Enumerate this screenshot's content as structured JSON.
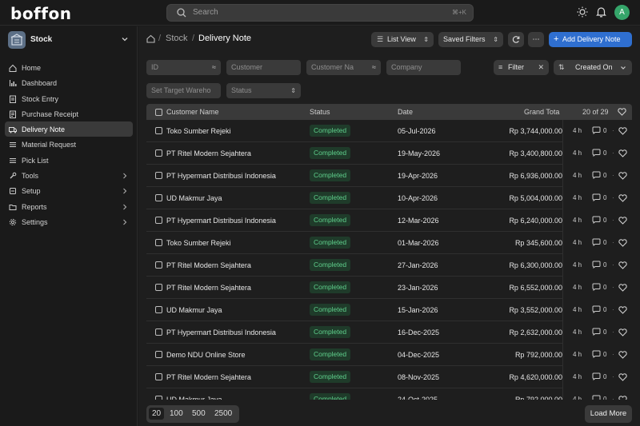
{
  "app": {
    "logo": "boffon"
  },
  "search": {
    "placeholder": "Search",
    "shortcut": "⌘+K"
  },
  "user": {
    "avatar_initial": "A"
  },
  "workspace": {
    "label": "Stock"
  },
  "sidebar": {
    "items": [
      {
        "label": "Home",
        "icon": "home-icon"
      },
      {
        "label": "Dashboard",
        "icon": "chart-icon"
      },
      {
        "label": "Stock Entry",
        "icon": "doc-icon"
      },
      {
        "label": "Purchase Receipt",
        "icon": "receipt-icon"
      },
      {
        "label": "Delivery Note",
        "icon": "truck-icon",
        "active": true
      },
      {
        "label": "Material Request",
        "icon": "list-icon"
      },
      {
        "label": "Pick List",
        "icon": "list-icon"
      },
      {
        "label": "Tools",
        "icon": "tools-icon",
        "chevron": true
      },
      {
        "label": "Setup",
        "icon": "setup-icon",
        "chevron": true
      },
      {
        "label": "Reports",
        "icon": "folder-icon",
        "chevron": true
      },
      {
        "label": "Settings",
        "icon": "gear-icon",
        "chevron": true
      }
    ]
  },
  "breadcrumb": {
    "section": "Stock",
    "page": "Delivery Note"
  },
  "toolbar": {
    "list_view": "List View",
    "saved_filters": "Saved Filters",
    "add_label": "Add Delivery Note"
  },
  "filters": {
    "id": "ID",
    "customer": "Customer",
    "customer_name": "Customer Na",
    "company": "Company",
    "set_target_warehouse": "Set Target Wareho",
    "status": "Status",
    "filter_label": "Filter",
    "sort_label": "Created On"
  },
  "table": {
    "headers": {
      "customer_name": "Customer Name",
      "status": "Status",
      "date": "Date",
      "grand_total": "Grand Tota",
      "count": "20 of 29"
    },
    "rows": [
      {
        "customer": "Toko Sumber Rejeki",
        "status": "Completed",
        "date": "05-Jul-2026",
        "total": "Rp 3,744,000.00",
        "age": "4 h",
        "comments": "0"
      },
      {
        "customer": "PT Ritel Modern Sejahtera",
        "status": "Completed",
        "date": "19-May-2026",
        "total": "Rp 3,400,800.00",
        "age": "4 h",
        "comments": "0"
      },
      {
        "customer": "PT Hypermart Distribusi Indonesia",
        "status": "Completed",
        "date": "19-Apr-2026",
        "total": "Rp 6,936,000.00",
        "age": "4 h",
        "comments": "0"
      },
      {
        "customer": "UD Makmur Jaya",
        "status": "Completed",
        "date": "10-Apr-2026",
        "total": "Rp 5,004,000.00",
        "age": "4 h",
        "comments": "0"
      },
      {
        "customer": "PT Hypermart Distribusi Indonesia",
        "status": "Completed",
        "date": "12-Mar-2026",
        "total": "Rp 6,240,000.00",
        "age": "4 h",
        "comments": "0"
      },
      {
        "customer": "Toko Sumber Rejeki",
        "status": "Completed",
        "date": "01-Mar-2026",
        "total": "Rp 345,600.00",
        "age": "4 h",
        "comments": "0"
      },
      {
        "customer": "PT Ritel Modern Sejahtera",
        "status": "Completed",
        "date": "27-Jan-2026",
        "total": "Rp 6,300,000.00",
        "age": "4 h",
        "comments": "0"
      },
      {
        "customer": "PT Ritel Modern Sejahtera",
        "status": "Completed",
        "date": "23-Jan-2026",
        "total": "Rp 6,552,000.00",
        "age": "4 h",
        "comments": "0"
      },
      {
        "customer": "UD Makmur Jaya",
        "status": "Completed",
        "date": "15-Jan-2026",
        "total": "Rp 3,552,000.00",
        "age": "4 h",
        "comments": "0"
      },
      {
        "customer": "PT Hypermart Distribusi Indonesia",
        "status": "Completed",
        "date": "16-Dec-2025",
        "total": "Rp 2,632,000.00",
        "age": "4 h",
        "comments": "0"
      },
      {
        "customer": "Demo NDU Online Store",
        "status": "Completed",
        "date": "04-Dec-2025",
        "total": "Rp 792,000.00",
        "age": "4 h",
        "comments": "0"
      },
      {
        "customer": "PT Ritel Modern Sejahtera",
        "status": "Completed",
        "date": "08-Nov-2025",
        "total": "Rp 4,620,000.00",
        "age": "4 h",
        "comments": "0"
      },
      {
        "customer": "UD Makmur Jaya",
        "status": "Completed",
        "date": "24-Oct-2025",
        "total": "Rp 792,000.00",
        "age": "4 h",
        "comments": "0"
      }
    ]
  },
  "pagination": {
    "sizes": [
      "20",
      "100",
      "500",
      "2500"
    ],
    "selected": "20",
    "load_more": "Load More"
  },
  "colors": {
    "primary": "#2f6fd0",
    "success_text": "#5fd08c",
    "success_bg": "#1f3b2a",
    "avatar": "#35a56a"
  }
}
